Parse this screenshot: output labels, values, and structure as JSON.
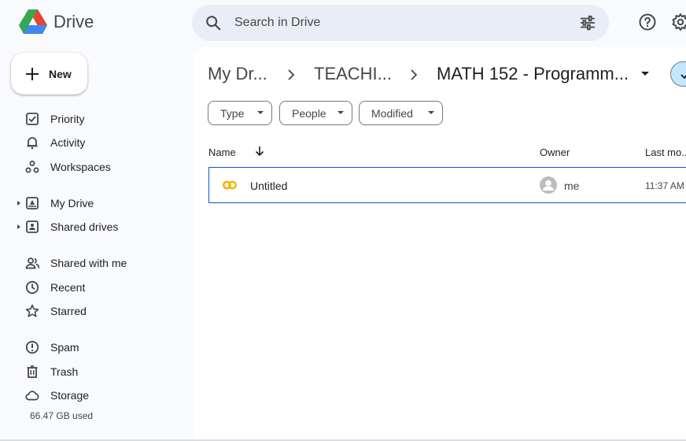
{
  "app": {
    "name": "Drive"
  },
  "search": {
    "placeholder": "Search in Drive"
  },
  "sidebar": {
    "new_label": "New",
    "items": [
      {
        "label": "Priority",
        "icon": "priority-icon"
      },
      {
        "label": "Activity",
        "icon": "bell-icon"
      },
      {
        "label": "Workspaces",
        "icon": "workspaces-icon"
      },
      {
        "label": "My Drive",
        "icon": "my-drive-icon",
        "expandable": true
      },
      {
        "label": "Shared drives",
        "icon": "shared-drives-icon",
        "expandable": true
      },
      {
        "label": "Shared with me",
        "icon": "people-icon"
      },
      {
        "label": "Recent",
        "icon": "clock-icon"
      },
      {
        "label": "Starred",
        "icon": "star-icon"
      },
      {
        "label": "Spam",
        "icon": "spam-icon"
      },
      {
        "label": "Trash",
        "icon": "trash-icon"
      },
      {
        "label": "Storage",
        "icon": "cloud-icon"
      }
    ],
    "storage_used": "66.47 GB used"
  },
  "breadcrumb": {
    "items": [
      "My Dr...",
      "TEACHI...",
      "MATH 152 - Programm..."
    ]
  },
  "filters": [
    "Type",
    "People",
    "Modified"
  ],
  "table": {
    "headers": {
      "name": "Name",
      "owner": "Owner",
      "modified": "Last mo..."
    },
    "rows": [
      {
        "name": "Untitled",
        "owner": "me",
        "modified": "11:37 AM"
      }
    ]
  },
  "colors": {
    "background": "#f8fafd",
    "search_bg": "#e9eef6",
    "selected_border": "#0b57d0",
    "file_icon": "#f4b400",
    "toggle_bg": "#c2e7ff"
  }
}
